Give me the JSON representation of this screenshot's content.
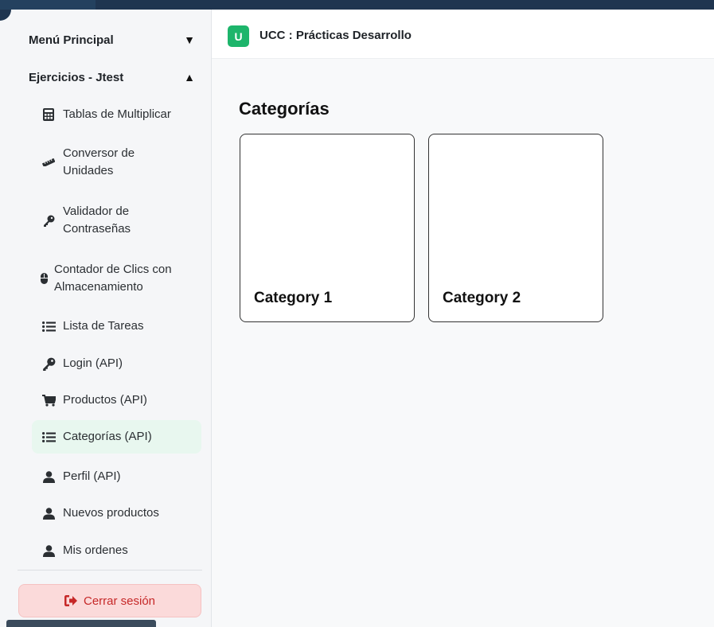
{
  "header": {
    "badge": "U",
    "title": "UCC : Prácticas Desarrollo"
  },
  "sidebar": {
    "main_menu": {
      "label": "Menú Principal",
      "arrow": "▼"
    },
    "exercises": {
      "label": "Ejercicios - Jtest",
      "arrow": "▲"
    },
    "items": [
      {
        "label": "Tablas de Multiplicar",
        "icon": "calculator-icon"
      },
      {
        "label": "Conversor de Unidades",
        "icon": "ruler-icon"
      },
      {
        "label": "Validador de Contraseñas",
        "icon": "key-icon"
      },
      {
        "label": "Contador de Clics con Almacenamiento",
        "icon": "mouse-icon"
      },
      {
        "label": "Lista de Tareas",
        "icon": "list-icon"
      },
      {
        "label": "Login (API)",
        "icon": "key-icon"
      },
      {
        "label": "Productos (API)",
        "icon": "cart-icon"
      },
      {
        "label": "Categorías (API)",
        "icon": "list-icon",
        "active": true
      },
      {
        "label": "Perfil (API)",
        "icon": "user-icon"
      },
      {
        "label": "Nuevos productos",
        "icon": "user-icon"
      },
      {
        "label": "Mis ordenes",
        "icon": "user-icon"
      }
    ],
    "logout": {
      "label": "Cerrar sesión",
      "icon": "sign-out-icon"
    }
  },
  "main": {
    "title": "Categorías",
    "categories": [
      {
        "name": "Category 1"
      },
      {
        "name": "Category 2"
      }
    ]
  },
  "colors": {
    "accent": "#1db56b",
    "active_bg": "#e8f7ef",
    "logout_bg": "#fbdada",
    "logout_text": "#c62828",
    "top_bar": "#1f3550"
  }
}
